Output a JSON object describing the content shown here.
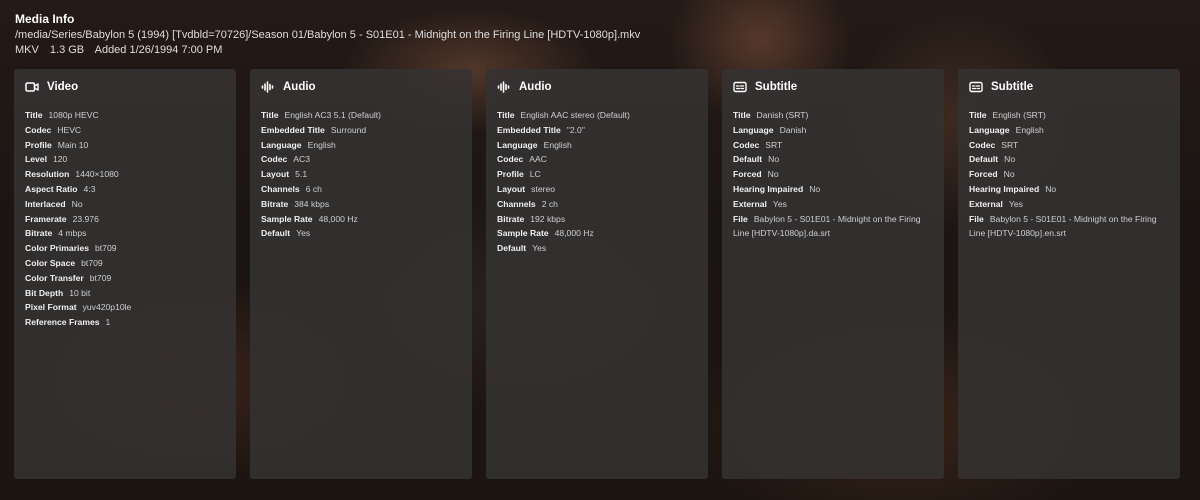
{
  "header": {
    "title": "Media Info",
    "path": "/media/Series/Babylon 5 (1994) [Tvdbld=70726]/Season 01/Babylon 5 - S01E01 - Midnight on the Firing Line [HDTV-1080p].mkv",
    "container": "MKV",
    "size": "1.3 GB",
    "added": "Added 1/26/1994 7:00 PM"
  },
  "cards": [
    {
      "icon": "video-camera-icon",
      "label": "Video",
      "rows": [
        {
          "k": "Title",
          "v": "1080p HEVC"
        },
        {
          "k": "Codec",
          "v": "HEVC"
        },
        {
          "k": "Profile",
          "v": "Main 10"
        },
        {
          "k": "Level",
          "v": "120"
        },
        {
          "k": "Resolution",
          "v": "1440×1080"
        },
        {
          "k": "Aspect Ratio",
          "v": "4:3"
        },
        {
          "k": "Interlaced",
          "v": "No"
        },
        {
          "k": "Framerate",
          "v": "23.976"
        },
        {
          "k": "Bitrate",
          "v": "4 mbps"
        },
        {
          "k": "Color Primaries",
          "v": "bt709"
        },
        {
          "k": "Color Space",
          "v": "bt709"
        },
        {
          "k": "Color Transfer",
          "v": "bt709"
        },
        {
          "k": "Bit Depth",
          "v": "10 bit"
        },
        {
          "k": "Pixel Format",
          "v": "yuv420p10le"
        },
        {
          "k": "Reference Frames",
          "v": "1"
        }
      ]
    },
    {
      "icon": "audio-waveform-icon",
      "label": "Audio",
      "rows": [
        {
          "k": "Title",
          "v": "English AC3 5.1 (Default)"
        },
        {
          "k": "Embedded Title",
          "v": "Surround"
        },
        {
          "k": "Language",
          "v": "English"
        },
        {
          "k": "Codec",
          "v": "AC3"
        },
        {
          "k": "Layout",
          "v": "5.1"
        },
        {
          "k": "Channels",
          "v": "6 ch"
        },
        {
          "k": "Bitrate",
          "v": "384 kbps"
        },
        {
          "k": "Sample Rate",
          "v": "48,000 Hz"
        },
        {
          "k": "Default",
          "v": "Yes"
        }
      ]
    },
    {
      "icon": "audio-waveform-icon",
      "label": "Audio",
      "rows": [
        {
          "k": "Title",
          "v": "English AAC stereo (Default)"
        },
        {
          "k": "Embedded Title",
          "v": "\"2.0\""
        },
        {
          "k": "Language",
          "v": "English"
        },
        {
          "k": "Codec",
          "v": "AAC"
        },
        {
          "k": "Profile",
          "v": "LC"
        },
        {
          "k": "Layout",
          "v": "stereo"
        },
        {
          "k": "Channels",
          "v": "2 ch"
        },
        {
          "k": "Bitrate",
          "v": "192 kbps"
        },
        {
          "k": "Sample Rate",
          "v": "48,000 Hz"
        },
        {
          "k": "Default",
          "v": "Yes"
        }
      ]
    },
    {
      "icon": "subtitles-icon",
      "label": "Subtitle",
      "rows": [
        {
          "k": "Title",
          "v": "Danish (SRT)"
        },
        {
          "k": "Language",
          "v": "Danish"
        },
        {
          "k": "Codec",
          "v": "SRT"
        },
        {
          "k": "Default",
          "v": "No"
        },
        {
          "k": "Forced",
          "v": "No"
        },
        {
          "k": "Hearing Impaired",
          "v": "No"
        },
        {
          "k": "External",
          "v": "Yes"
        },
        {
          "k": "File",
          "v": "Babylon 5 - S01E01 - Midnight on the Firing Line [HDTV-1080p].da.srt"
        }
      ]
    },
    {
      "icon": "subtitles-icon",
      "label": "Subtitle",
      "rows": [
        {
          "k": "Title",
          "v": "English (SRT)"
        },
        {
          "k": "Language",
          "v": "English"
        },
        {
          "k": "Codec",
          "v": "SRT"
        },
        {
          "k": "Default",
          "v": "No"
        },
        {
          "k": "Forced",
          "v": "No"
        },
        {
          "k": "Hearing Impaired",
          "v": "No"
        },
        {
          "k": "External",
          "v": "Yes"
        },
        {
          "k": "File",
          "v": "Babylon 5 - S01E01 - Midnight on the Firing Line [HDTV-1080p].en.srt"
        }
      ]
    }
  ]
}
